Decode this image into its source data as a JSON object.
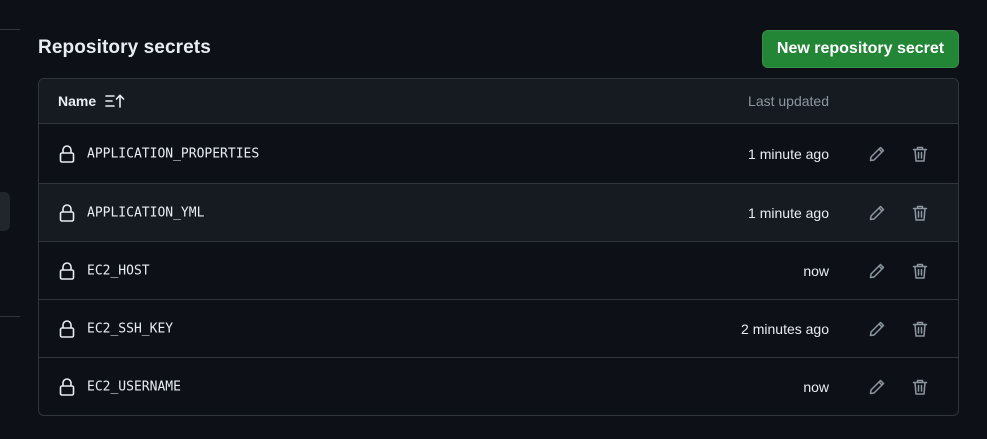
{
  "section": {
    "title": "Repository secrets",
    "new_button_label": "New repository secret"
  },
  "table": {
    "columns": {
      "name": "Name",
      "last_updated": "Last updated"
    },
    "rows": [
      {
        "name": "APPLICATION_PROPERTIES",
        "updated": "1 minute ago"
      },
      {
        "name": "APPLICATION_YML",
        "updated": "1 minute ago"
      },
      {
        "name": "EC2_HOST",
        "updated": "now"
      },
      {
        "name": "EC2_SSH_KEY",
        "updated": "2 minutes ago"
      },
      {
        "name": "EC2_USERNAME",
        "updated": "now"
      }
    ]
  },
  "icons": {
    "row_icon": "lock-icon",
    "edit": "pencil-icon",
    "delete": "trash-icon",
    "sort": "sort-ascending-icon"
  },
  "colors": {
    "primary_button": "#238636",
    "background": "#0d1117",
    "border": "#30363d",
    "muted_text": "#8d96a0"
  }
}
